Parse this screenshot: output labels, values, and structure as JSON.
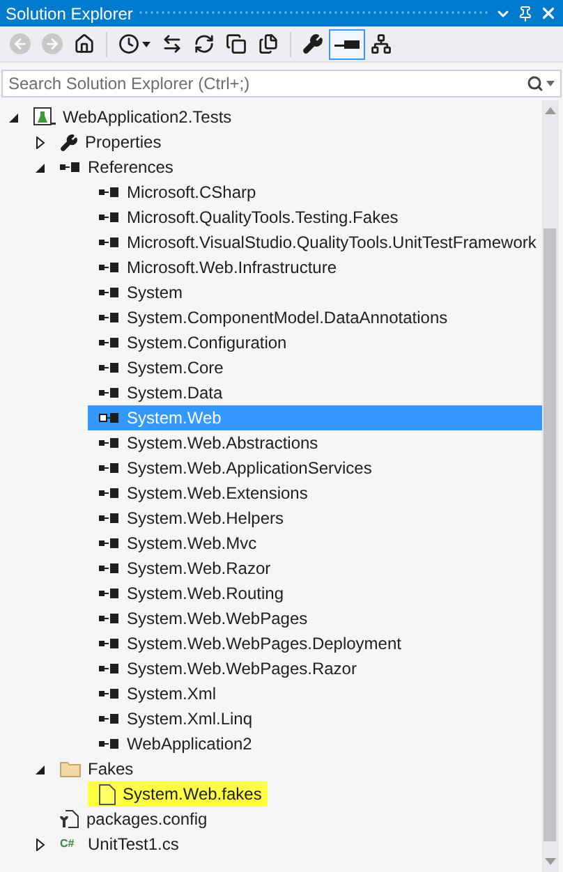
{
  "window": {
    "title": "Solution Explorer"
  },
  "toolbar": [
    {
      "kind": "back",
      "disabled": true,
      "pressed": false
    },
    {
      "kind": "forward",
      "disabled": true,
      "pressed": false
    },
    {
      "kind": "home",
      "disabled": false,
      "pressed": false
    },
    {
      "kind": "history",
      "disabled": false,
      "pressed": false
    },
    {
      "kind": "sync",
      "disabled": false,
      "pressed": false
    },
    {
      "kind": "refresh",
      "disabled": false,
      "pressed": false
    },
    {
      "kind": "collapse",
      "disabled": false,
      "pressed": false
    },
    {
      "kind": "show-all",
      "disabled": false,
      "pressed": false
    },
    {
      "kind": "properties",
      "disabled": false,
      "pressed": false
    },
    {
      "kind": "preview",
      "disabled": false,
      "pressed": true
    },
    {
      "kind": "new-view",
      "disabled": false,
      "pressed": false
    }
  ],
  "search": {
    "placeholder": "Search Solution Explorer (Ctrl+;)"
  },
  "tree": [
    {
      "label": "WebApplication2.Tests",
      "kind": "project",
      "expanded": true,
      "selected": false,
      "highlighted": false,
      "children": [
        {
          "label": "Properties",
          "kind": "properties",
          "expanded": false,
          "selected": false,
          "highlighted": false
        },
        {
          "label": "References",
          "kind": "references",
          "expanded": true,
          "selected": false,
          "highlighted": false,
          "children": [
            {
              "label": "Microsoft.CSharp",
              "kind": "reference",
              "selected": false,
              "highlighted": false
            },
            {
              "label": "Microsoft.QualityTools.Testing.Fakes",
              "kind": "reference",
              "selected": false,
              "highlighted": false
            },
            {
              "label": "Microsoft.VisualStudio.QualityTools.UnitTestFramework",
              "kind": "reference",
              "selected": false,
              "highlighted": false
            },
            {
              "label": "Microsoft.Web.Infrastructure",
              "kind": "reference",
              "selected": false,
              "highlighted": false
            },
            {
              "label": "System",
              "kind": "reference",
              "selected": false,
              "highlighted": false
            },
            {
              "label": "System.ComponentModel.DataAnnotations",
              "kind": "reference",
              "selected": false,
              "highlighted": false
            },
            {
              "label": "System.Configuration",
              "kind": "reference",
              "selected": false,
              "highlighted": false
            },
            {
              "label": "System.Core",
              "kind": "reference",
              "selected": false,
              "highlighted": false
            },
            {
              "label": "System.Data",
              "kind": "reference",
              "selected": false,
              "highlighted": false
            },
            {
              "label": "System.Web",
              "kind": "reference",
              "selected": true,
              "highlighted": false
            },
            {
              "label": "System.Web.Abstractions",
              "kind": "reference",
              "selected": false,
              "highlighted": false
            },
            {
              "label": "System.Web.ApplicationServices",
              "kind": "reference",
              "selected": false,
              "highlighted": false
            },
            {
              "label": "System.Web.Extensions",
              "kind": "reference",
              "selected": false,
              "highlighted": false
            },
            {
              "label": "System.Web.Helpers",
              "kind": "reference",
              "selected": false,
              "highlighted": false
            },
            {
              "label": "System.Web.Mvc",
              "kind": "reference",
              "selected": false,
              "highlighted": false
            },
            {
              "label": "System.Web.Razor",
              "kind": "reference",
              "selected": false,
              "highlighted": false
            },
            {
              "label": "System.Web.Routing",
              "kind": "reference",
              "selected": false,
              "highlighted": false
            },
            {
              "label": "System.Web.WebPages",
              "kind": "reference",
              "selected": false,
              "highlighted": false
            },
            {
              "label": "System.Web.WebPages.Deployment",
              "kind": "reference",
              "selected": false,
              "highlighted": false
            },
            {
              "label": "System.Web.WebPages.Razor",
              "kind": "reference",
              "selected": false,
              "highlighted": false
            },
            {
              "label": "System.Xml",
              "kind": "reference",
              "selected": false,
              "highlighted": false
            },
            {
              "label": "System.Xml.Linq",
              "kind": "reference",
              "selected": false,
              "highlighted": false
            },
            {
              "label": "WebApplication2",
              "kind": "reference",
              "selected": false,
              "highlighted": false
            }
          ]
        },
        {
          "label": "Fakes",
          "kind": "folder",
          "expanded": true,
          "selected": false,
          "highlighted": false,
          "children": [
            {
              "label": "System.Web.fakes",
              "kind": "file",
              "selected": false,
              "highlighted": true
            }
          ]
        },
        {
          "label": "packages.config",
          "kind": "config",
          "selected": false,
          "highlighted": false
        },
        {
          "label": "UnitTest1.cs",
          "kind": "csharp",
          "badge": "C#",
          "expanded": false,
          "selected": false,
          "highlighted": false
        }
      ]
    }
  ]
}
